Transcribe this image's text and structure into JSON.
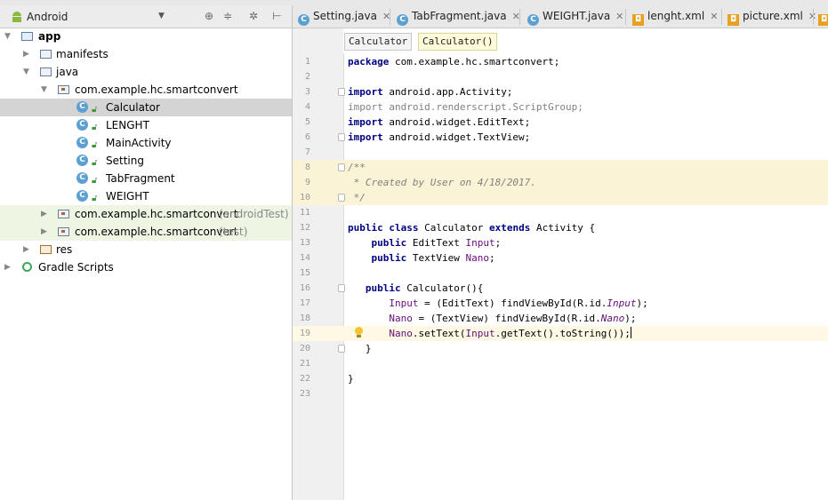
{
  "project_panel": {
    "view_label": "Android",
    "tree": [
      {
        "label": "app",
        "bold": true
      },
      {
        "label": "manifests"
      },
      {
        "label": "java"
      },
      {
        "label": "com.example.hc.smartconvert"
      },
      {
        "label": "Calculator"
      },
      {
        "label": "LENGHT"
      },
      {
        "label": "MainActivity"
      },
      {
        "label": "Setting"
      },
      {
        "label": "TabFragment"
      },
      {
        "label": "WEIGHT"
      },
      {
        "label": "com.example.hc.smartconvert",
        "suffix": "(androidTest)"
      },
      {
        "label": "com.example.hc.smartconvert",
        "suffix": "(test)"
      },
      {
        "label": "res"
      },
      {
        "label": "Gradle Scripts"
      }
    ]
  },
  "tabs": [
    {
      "label": "Setting.java"
    },
    {
      "label": "TabFragment.java"
    },
    {
      "label": "WEIGHT.java"
    },
    {
      "label": "lenght.xml"
    },
    {
      "label": "picture.xml"
    }
  ],
  "breadcrumbs": [
    "Calculator",
    "Calculator()"
  ],
  "code_lines": [
    {
      "n": "1",
      "parts": [
        [
          "kw",
          "package"
        ],
        [
          "",
          "com.example.hc.smartconvert;"
        ]
      ]
    },
    {
      "n": "2",
      "parts": []
    },
    {
      "n": "3",
      "parts": [
        [
          "kw",
          "import"
        ],
        [
          "",
          "android.app.Activity;"
        ]
      ]
    },
    {
      "n": "4",
      "parts": [
        [
          "gr",
          "import android.renderscript.ScriptGroup;"
        ]
      ]
    },
    {
      "n": "5",
      "parts": [
        [
          "kw",
          "import"
        ],
        [
          "",
          "android.widget.EditText;"
        ]
      ]
    },
    {
      "n": "6",
      "parts": [
        [
          "kw",
          "import"
        ],
        [
          "",
          "android.widget.TextView;"
        ]
      ]
    },
    {
      "n": "7",
      "parts": []
    },
    {
      "n": "8",
      "parts": [
        [
          "it",
          "/**"
        ]
      ]
    },
    {
      "n": "9",
      "parts": [
        [
          "it",
          " * Created by User on 4/18/2017."
        ]
      ]
    },
    {
      "n": "10",
      "parts": [
        [
          "it",
          " */"
        ]
      ]
    },
    {
      "n": "11",
      "parts": []
    },
    {
      "n": "12",
      "parts": [
        [
          "kw",
          "public class"
        ],
        [
          "",
          " Calculator "
        ],
        [
          "kw",
          "extends"
        ],
        [
          "",
          " Activity {"
        ]
      ]
    },
    {
      "n": "13",
      "parts": [
        [
          "",
          "    "
        ],
        [
          "kw",
          "public"
        ],
        [
          "",
          " EditText "
        ],
        [
          "fld",
          "Input"
        ],
        [
          "",
          ";"
        ]
      ]
    },
    {
      "n": "14",
      "parts": [
        [
          "",
          "    "
        ],
        [
          "kw",
          "public"
        ],
        [
          "",
          " TextView "
        ],
        [
          "fld",
          "Nano"
        ],
        [
          "",
          ";"
        ]
      ]
    },
    {
      "n": "15",
      "parts": []
    },
    {
      "n": "16",
      "parts": [
        [
          "",
          "   "
        ],
        [
          "kw",
          "public"
        ],
        [
          "",
          " Calculator(){"
        ]
      ]
    },
    {
      "n": "17",
      "parts": [
        [
          "",
          "       "
        ],
        [
          "fld",
          "Input"
        ],
        [
          "",
          " = (EditText) findViewById(R.id."
        ],
        [
          "fldi",
          "Input"
        ],
        [
          "",
          ");"
        ]
      ]
    },
    {
      "n": "18",
      "parts": [
        [
          "",
          "       "
        ],
        [
          "fld",
          "Nano"
        ],
        [
          "",
          " = (TextView) findViewById(R.id."
        ],
        [
          "fldi",
          "Nano"
        ],
        [
          "",
          ");"
        ]
      ]
    },
    {
      "n": "19",
      "parts": [
        [
          "",
          "       "
        ],
        [
          "fld",
          "Nano"
        ],
        [
          "",
          ".setText("
        ],
        [
          "fld",
          "Input"
        ],
        [
          "",
          ".getText().toString());"
        ]
      ]
    },
    {
      "n": "20",
      "parts": [
        [
          "",
          "   }"
        ]
      ]
    },
    {
      "n": "21",
      "parts": []
    },
    {
      "n": "22",
      "parts": [
        [
          "",
          "}"
        ]
      ]
    },
    {
      "n": "23",
      "parts": []
    }
  ]
}
